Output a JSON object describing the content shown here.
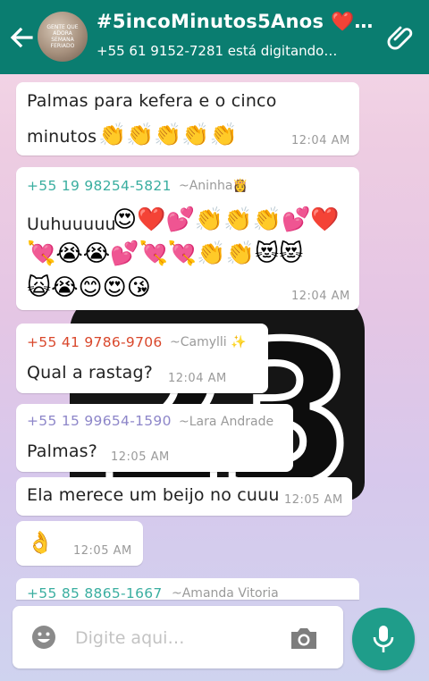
{
  "header": {
    "title": "#5incoMinutos5Anos ❤️…",
    "status": "+55 61 9152-7281 está digitando…",
    "avatar_text": "GENTE QUE ADORA SEMANA FERIADO",
    "back_icon": "back-arrow-icon",
    "attach_icon": "paperclip-icon"
  },
  "colors": {
    "header_bg": "#0a7d70",
    "mic_bg": "#1f9d8a",
    "sender_teal": "#3aaea0",
    "sender_red": "#d9472b",
    "sender_purple": "#8d86c9"
  },
  "messages": [
    {
      "line1": "Palmas para kefera e o cinco",
      "line2": "minutos",
      "emojis": "👏👏👏👏👏",
      "time": "12:04 AM"
    },
    {
      "sender": "+55 19 98254-5821",
      "nick": "~Aninha👸",
      "text": "Uuhuuuuu",
      "emojis_line1": "😍❤️💕👏👏👏💕❤️",
      "emojis_line2": "💘😭😭💕💘💘👏👏😻😻",
      "emojis_line3": "🙀😭😊😍😘",
      "time": "12:04 AM"
    },
    {
      "sender": "+55 41 9786-9706",
      "nick": "~Camylli ✨",
      "text": "Qual a rastag?",
      "time": "12:04 AM"
    },
    {
      "sender": "+55 15 99654-1590",
      "nick": "~Lara Andrade",
      "text": "Palmas?",
      "time": "12:05 AM"
    },
    {
      "text": "Ela  merece um beijo no cuuu",
      "time": "12:05 AM"
    },
    {
      "emoji": "👌",
      "time": "12:05 AM"
    },
    {
      "sender": "+55 85 8865-1667",
      "nick": "~Amanda Vitoria"
    }
  ],
  "input": {
    "placeholder": "Digite aqui…",
    "emoji_icon": "smiley-icon",
    "camera_icon": "camera-icon",
    "mic_icon": "mic-icon"
  }
}
